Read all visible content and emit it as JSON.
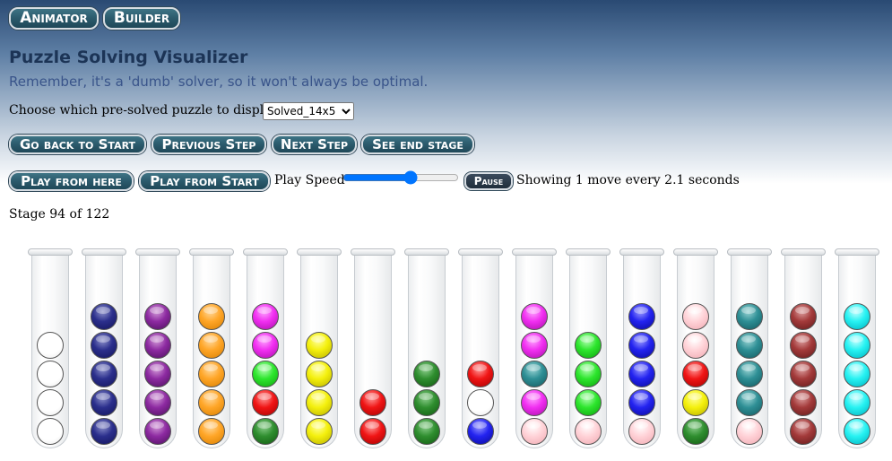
{
  "top_nav": {
    "animator_label": "Animator",
    "builder_label": "Builder"
  },
  "header": {
    "title": "Puzzle Solving Visualizer",
    "subtitle": "Remember, it's a 'dumb' solver, so it won't always be optimal."
  },
  "puzzle_picker": {
    "label": "Choose which pre-solved puzzle to display:",
    "selected": "Solved_14x5"
  },
  "step_controls": {
    "go_back_label": "Go back to Start",
    "previous_label": "Previous Step",
    "next_label": "Next Step",
    "end_label": "See end stage"
  },
  "play_controls": {
    "play_here_label": "Play from here",
    "play_start_label": "Play from Start",
    "speed_label": "Play Speed",
    "speed_value": 60,
    "pause_label": "Pause",
    "status": "Showing 1 move every 2.1 seconds"
  },
  "stage": {
    "text": "Stage 94 of 122"
  },
  "colors": {
    "accent_button": "#2b5a6c",
    "header_dark": "#2a4a73",
    "title_text": "#1c3456"
  },
  "tubes": [
    [
      "white",
      "white",
      "white",
      "white"
    ],
    [
      "navy",
      "navy",
      "navy",
      "navy",
      "navy"
    ],
    [
      "purple",
      "purple",
      "purple",
      "purple",
      "purple"
    ],
    [
      "orange",
      "orange",
      "orange",
      "orange",
      "orange"
    ],
    [
      "dkgreen",
      "red",
      "green",
      "magenta",
      "magenta"
    ],
    [
      "yellow",
      "yellow",
      "yellow",
      "yellow"
    ],
    [
      "red",
      "red"
    ],
    [
      "dkgreen",
      "dkgreen",
      "dkgreen"
    ],
    [
      "blue",
      "white",
      "red"
    ],
    [
      "pink",
      "magenta",
      "teal",
      "magenta",
      "magenta"
    ],
    [
      "pink",
      "green",
      "green",
      "green"
    ],
    [
      "pink",
      "blue",
      "blue",
      "blue",
      "blue"
    ],
    [
      "dkgreen",
      "yellow",
      "red",
      "pink",
      "pink"
    ],
    [
      "pink",
      "teal",
      "teal",
      "teal",
      "teal"
    ],
    [
      "maroon",
      "maroon",
      "maroon",
      "maroon",
      "maroon"
    ],
    [
      "cyan",
      "cyan",
      "cyan",
      "cyan",
      "cyan"
    ]
  ]
}
